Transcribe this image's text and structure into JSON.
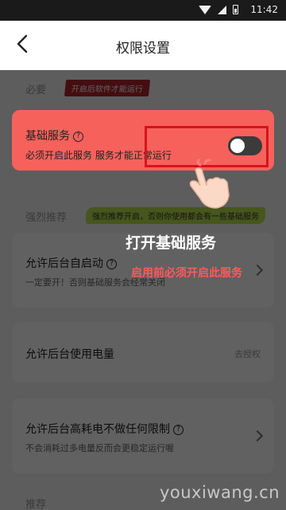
{
  "status_bar": {
    "time": "11:42"
  },
  "header": {
    "title": "权限设置"
  },
  "sections": {
    "required": {
      "label": "必要",
      "tag": "开启后软件才能运行"
    },
    "recommended": {
      "label": "强烈推荐",
      "tag": "强烈推荐开启，否则你使用都会有一些基础服务"
    },
    "more": {
      "label": "推荐"
    }
  },
  "cards": {
    "basic_service": {
      "title": "基础服务",
      "desc": "必须开启此服务 服务才能正常运行",
      "toggle_on": false
    },
    "autostart": {
      "title": "允许后台自启动",
      "desc": "一定要开！否则基础服务会经常关闭"
    },
    "battery": {
      "title": "允许后台使用电量",
      "status": "去授权"
    },
    "no_limit": {
      "title": "允许后台高耗电不做任何限制",
      "desc": "不会消耗过多电量反而会更稳定运行喔"
    }
  },
  "guide": {
    "title": "打开基础服务",
    "subtitle": "启用前必须开启此服务"
  },
  "watermark": "youxiwang.cn",
  "colors": {
    "accent": "#f7615c",
    "highlight_border": "#d6141b",
    "guide_sub": "#ff5a5a"
  }
}
